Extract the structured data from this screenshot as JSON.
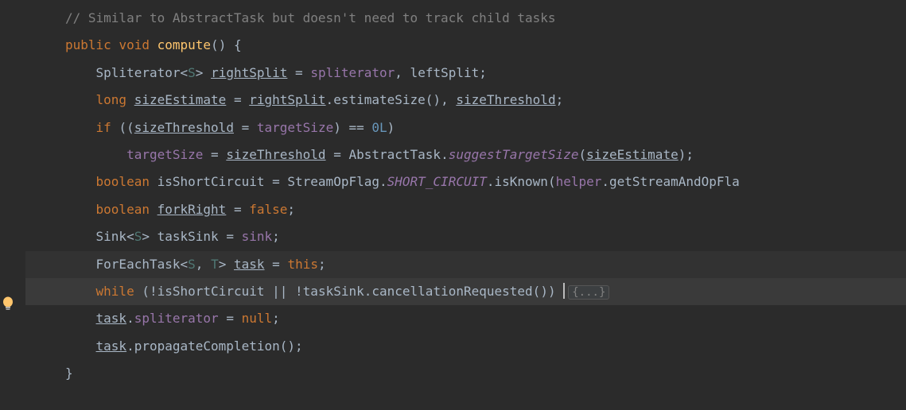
{
  "code": {
    "indent1": "    ",
    "indent2": "        ",
    "indent3": "            ",
    "comment_line": "// Similar to AbstractTask but doesn't need to track child tasks",
    "kw_public": "public",
    "kw_void": "void",
    "kw_long": "long",
    "kw_if": "if",
    "kw_boolean": "boolean",
    "kw_false": "false",
    "kw_this": "this",
    "kw_while": "while",
    "kw_null": "null",
    "method_name": "compute",
    "spliterator_type": "Spliterator",
    "generic_s": "S",
    "generic_t": "T",
    "rightSplit": "rightSplit",
    "spliterator_field": "spliterator",
    "leftSplit": " leftSplit",
    "sizeEstimate": "sizeEstimate",
    "estimateSize": "estimateSize",
    "sizeThreshold": "sizeThreshold",
    "targetSize": "targetSize",
    "zero_l": "0L",
    "abstractTask": "AbstractTask",
    "suggestTargetSize": "suggestTargetSize",
    "isShortCircuit": "isShortCircuit",
    "streamOpFlag": "StreamOpFlag",
    "short_circuit": "SHORT_CIRCUIT",
    "isKnown": "isKnown",
    "helper": "helper",
    "getStreamAndOpFla": "getStreamAndOpFla",
    "forkRight": "forkRight",
    "sink_type": "Sink",
    "taskSink": "taskSink",
    "sink_field": "sink",
    "forEachTask": "ForEachTask",
    "task": "task",
    "cancellationRequested": "cancellationRequested",
    "propagateCompletion": "propagateCompletion",
    "folded_text": "{...}",
    "paren_open": "(",
    "paren_close": ")",
    "brace_open": "{",
    "brace_close": "}",
    "lt": "<",
    "gt": ">",
    "eq": "=",
    "eqeq": "==",
    "semi": ";",
    "comma": ",",
    "dot": ".",
    "bang": "!",
    "oror": "||",
    "sp": " "
  }
}
